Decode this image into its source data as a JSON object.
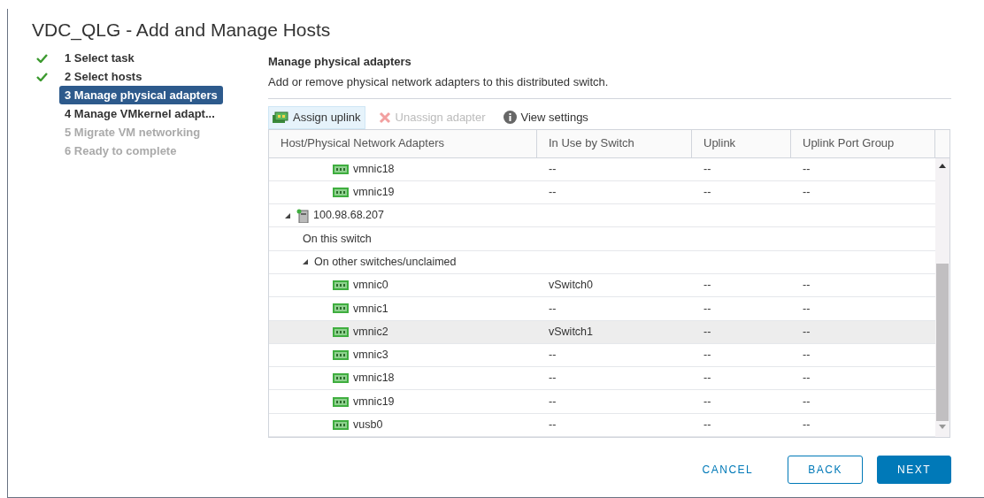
{
  "window": {
    "title": "VDC_QLG - Add and Manage Hosts"
  },
  "steps": [
    {
      "label": "1 Select task",
      "completed": true,
      "disabled": false,
      "selected": false
    },
    {
      "label": "2 Select hosts",
      "completed": true,
      "disabled": false,
      "selected": false
    },
    {
      "label": "3 Manage physical adapters",
      "completed": false,
      "disabled": false,
      "selected": true
    },
    {
      "label": "4 Manage VMkernel adapt...",
      "completed": false,
      "disabled": false,
      "selected": false
    },
    {
      "label": "5 Migrate VM networking",
      "completed": false,
      "disabled": true,
      "selected": false
    },
    {
      "label": "6 Ready to complete",
      "completed": false,
      "disabled": true,
      "selected": false
    }
  ],
  "page": {
    "title": "Manage physical adapters",
    "description": "Add or remove physical network adapters to this distributed switch."
  },
  "toolbar": [
    {
      "label": "Assign uplink",
      "kind": "assign",
      "disabled": false,
      "selected": true
    },
    {
      "label": "Unassign adapter",
      "kind": "unassign",
      "disabled": true,
      "selected": false
    },
    {
      "label": "View settings",
      "kind": "info",
      "disabled": false,
      "selected": false
    }
  ],
  "table": {
    "columns": [
      "Host/Physical Network Adapters",
      "In Use by Switch",
      "Uplink",
      "Uplink Port Group"
    ],
    "rows": [
      {
        "kind": "adapter",
        "name": "vmnic18",
        "in_use": "--",
        "uplink": "--",
        "port_group": "--",
        "selected": false
      },
      {
        "kind": "adapter",
        "name": "vmnic19",
        "in_use": "--",
        "uplink": "--",
        "port_group": "--",
        "selected": false
      },
      {
        "kind": "host",
        "name": "100.98.68.207",
        "expanded": true,
        "selected": false,
        "children": [
          {
            "kind": "group",
            "name": "On this switch",
            "selected": false
          },
          {
            "kind": "group",
            "name": "On other switches/unclaimed",
            "expanded": true,
            "selected": false,
            "children": [
              {
                "kind": "adapter",
                "name": "vmnic0",
                "in_use": "vSwitch0",
                "uplink": "--",
                "port_group": "--",
                "selected": false
              },
              {
                "kind": "adapter",
                "name": "vmnic1",
                "in_use": "--",
                "uplink": "--",
                "port_group": "--",
                "selected": false
              },
              {
                "kind": "adapter",
                "name": "vmnic2",
                "in_use": "vSwitch1",
                "uplink": "--",
                "port_group": "--",
                "selected": true
              },
              {
                "kind": "adapter",
                "name": "vmnic3",
                "in_use": "--",
                "uplink": "--",
                "port_group": "--",
                "selected": false
              },
              {
                "kind": "adapter",
                "name": "vmnic18",
                "in_use": "--",
                "uplink": "--",
                "port_group": "--",
                "selected": false
              },
              {
                "kind": "adapter",
                "name": "vmnic19",
                "in_use": "--",
                "uplink": "--",
                "port_group": "--",
                "selected": false
              },
              {
                "kind": "adapter",
                "name": "vusb0",
                "in_use": "--",
                "uplink": "--",
                "port_group": "--",
                "selected": false
              }
            ]
          }
        ]
      }
    ]
  },
  "buttons": [
    {
      "label": "CANCEL",
      "kind": "flat"
    },
    {
      "label": "BACK",
      "kind": "outline"
    },
    {
      "label": "NEXT",
      "kind": "primary"
    }
  ]
}
